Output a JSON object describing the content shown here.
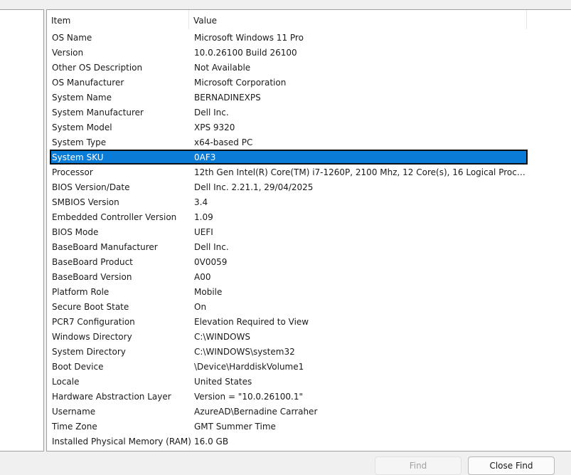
{
  "table": {
    "headers": {
      "item": "Item",
      "value": "Value"
    },
    "rows": [
      {
        "item": "OS Name",
        "value": "Microsoft Windows 11 Pro"
      },
      {
        "item": "Version",
        "value": "10.0.26100 Build 26100"
      },
      {
        "item": "Other OS Description",
        "value": "Not Available"
      },
      {
        "item": "OS Manufacturer",
        "value": "Microsoft Corporation"
      },
      {
        "item": "System Name",
        "value": "BERNADINEXPS"
      },
      {
        "item": "System Manufacturer",
        "value": "Dell Inc."
      },
      {
        "item": "System Model",
        "value": "XPS 9320"
      },
      {
        "item": "System Type",
        "value": "x64-based PC"
      },
      {
        "item": "System SKU",
        "value": "0AF3"
      },
      {
        "item": "Processor",
        "value": "12th Gen Intel(R) Core(TM) i7-1260P, 2100 Mhz, 12 Core(s), 16 Logical Proces..."
      },
      {
        "item": "BIOS Version/Date",
        "value": "Dell Inc. 2.21.1, 29/04/2025"
      },
      {
        "item": "SMBIOS Version",
        "value": "3.4"
      },
      {
        "item": "Embedded Controller Version",
        "value": "1.09"
      },
      {
        "item": "BIOS Mode",
        "value": "UEFI"
      },
      {
        "item": "BaseBoard Manufacturer",
        "value": "Dell Inc."
      },
      {
        "item": "BaseBoard Product",
        "value": "0V0059"
      },
      {
        "item": "BaseBoard Version",
        "value": "A00"
      },
      {
        "item": "Platform Role",
        "value": "Mobile"
      },
      {
        "item": "Secure Boot State",
        "value": "On"
      },
      {
        "item": "PCR7 Configuration",
        "value": "Elevation Required to View"
      },
      {
        "item": "Windows Directory",
        "value": "C:\\WINDOWS"
      },
      {
        "item": "System Directory",
        "value": "C:\\WINDOWS\\system32"
      },
      {
        "item": "Boot Device",
        "value": "\\Device\\HarddiskVolume1"
      },
      {
        "item": "Locale",
        "value": "United States"
      },
      {
        "item": "Hardware Abstraction Layer",
        "value": "Version = \"10.0.26100.1\""
      },
      {
        "item": "Username",
        "value": "AzureAD\\Bernadine Carraher"
      },
      {
        "item": "Time Zone",
        "value": "GMT Summer Time"
      },
      {
        "item": "Installed Physical Memory (RAM)",
        "value": "16.0 GB"
      }
    ],
    "selected_item": "System SKU"
  },
  "buttons": {
    "find_label": "Find",
    "close_find_label": "Close Find"
  },
  "colors": {
    "selection": "#0a7bd6",
    "background": "#f0f0f0",
    "pane": "#ffffff"
  }
}
